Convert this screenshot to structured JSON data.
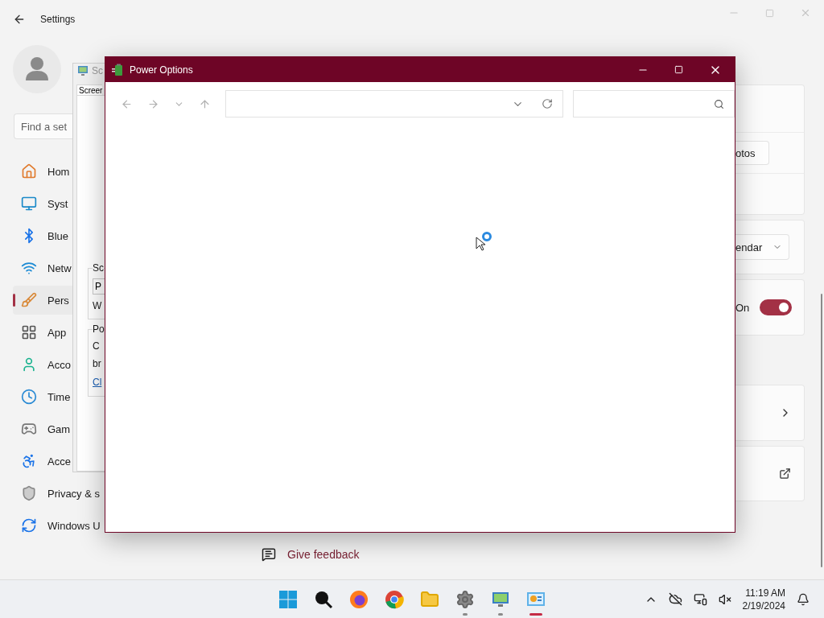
{
  "settings": {
    "title": "Settings",
    "search": {
      "placeholder": "Find a set"
    },
    "nav": [
      {
        "label": "Hom",
        "selected": false
      },
      {
        "label": "Syst",
        "selected": false
      },
      {
        "label": "Blue",
        "selected": false
      },
      {
        "label": "Netw",
        "selected": false
      },
      {
        "label": "Pers",
        "selected": true
      },
      {
        "label": "App",
        "selected": false
      },
      {
        "label": "Acco",
        "selected": false
      },
      {
        "label": "Time",
        "selected": false
      },
      {
        "label": "Gam",
        "selected": false
      },
      {
        "label": "Acce",
        "selected": false
      },
      {
        "label": "Privacy & s",
        "selected": false
      },
      {
        "label": "Windows U",
        "selected": false
      }
    ],
    "sections": [
      {
        "cards": [
          {
            "rows": [
              {
                "kind": "blank"
              },
              {
                "kind": "button",
                "label": "otos"
              },
              {
                "kind": "blank"
              }
            ]
          },
          {
            "rows": [
              {
                "kind": "dropdown",
                "label": "endar"
              }
            ]
          },
          {
            "rows": [
              {
                "kind": "toggle",
                "label": "On",
                "on": true
              }
            ]
          }
        ]
      },
      {
        "cards": [
          {
            "rows": [
              {
                "kind": "chevron"
              }
            ]
          },
          {
            "rows": [
              {
                "kind": "external"
              }
            ]
          }
        ]
      }
    ],
    "feedback": "Give feedback"
  },
  "dialog": {
    "title": "Sc",
    "tab": "Screer",
    "groups": [
      {
        "label": "Sc",
        "lines": [
          {
            "kind": "select",
            "text": "P"
          },
          {
            "kind": "text",
            "text": "W"
          }
        ]
      },
      {
        "label": "Po",
        "lines": [
          {
            "kind": "text",
            "text": "C"
          },
          {
            "kind": "text",
            "text": "br"
          },
          {
            "kind": "link",
            "text": "Cl"
          }
        ]
      }
    ]
  },
  "power_window": {
    "title": "Power Options"
  },
  "taskbar": {
    "apps": [
      {
        "open": false,
        "active": false
      },
      {
        "open": false,
        "active": false
      },
      {
        "open": false,
        "active": false
      },
      {
        "open": false,
        "active": false
      },
      {
        "open": false,
        "active": false
      },
      {
        "open": true,
        "active": false
      },
      {
        "open": true,
        "active": false
      },
      {
        "open": true,
        "active": true
      }
    ],
    "time": "11:19 AM",
    "date": "2/19/2024"
  }
}
